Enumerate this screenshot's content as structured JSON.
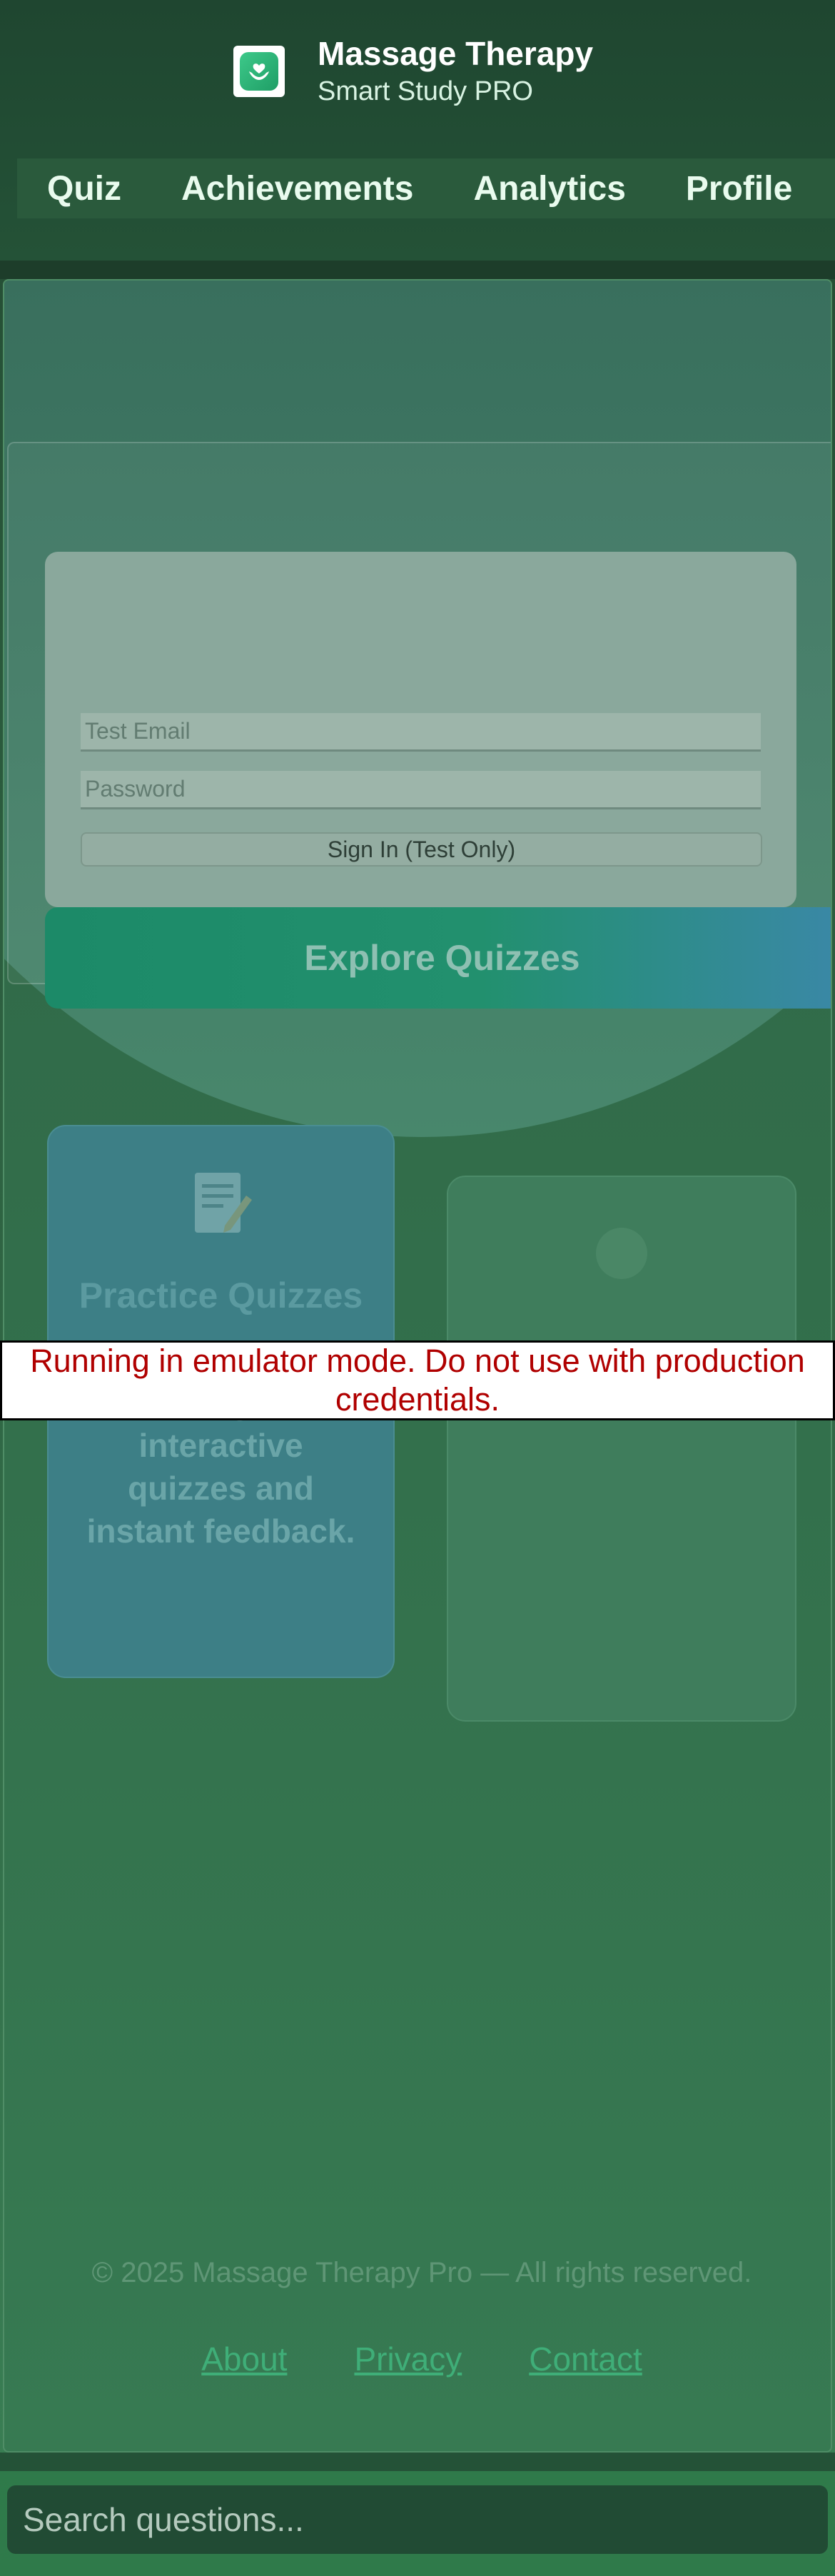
{
  "header": {
    "title": "Massage Therapy",
    "subtitle": "Smart Study PRO",
    "logo_icon": "hands-heart-icon"
  },
  "nav": {
    "items": [
      {
        "label": "Quiz"
      },
      {
        "label": "Achievements"
      },
      {
        "label": "Analytics"
      },
      {
        "label": "Profile"
      }
    ]
  },
  "auth": {
    "email_placeholder": "Test Email",
    "password_placeholder": "Password",
    "signin_label": "Sign In (Test Only)"
  },
  "hero": {
    "explore_label": "Explore Quizzes"
  },
  "features": [
    {
      "icon": "clipboard-pencil-icon",
      "title": "Practice Quizzes",
      "description": "Test your knowledge with interactive quizzes and instant feedback."
    },
    {
      "icon": "chart-icon",
      "title": "",
      "description": ""
    }
  ],
  "warning": {
    "text": "Running in emulator mode. Do not use with production credentials."
  },
  "footer": {
    "copyright": "© 2025 Massage Therapy Pro — All rights reserved.",
    "links": [
      {
        "label": "About"
      },
      {
        "label": "Privacy"
      },
      {
        "label": "Contact"
      }
    ]
  },
  "search": {
    "placeholder": "Search questions..."
  },
  "colors": {
    "accent": "#22906e",
    "warning_text": "#b00000",
    "link": "#3fae78"
  }
}
